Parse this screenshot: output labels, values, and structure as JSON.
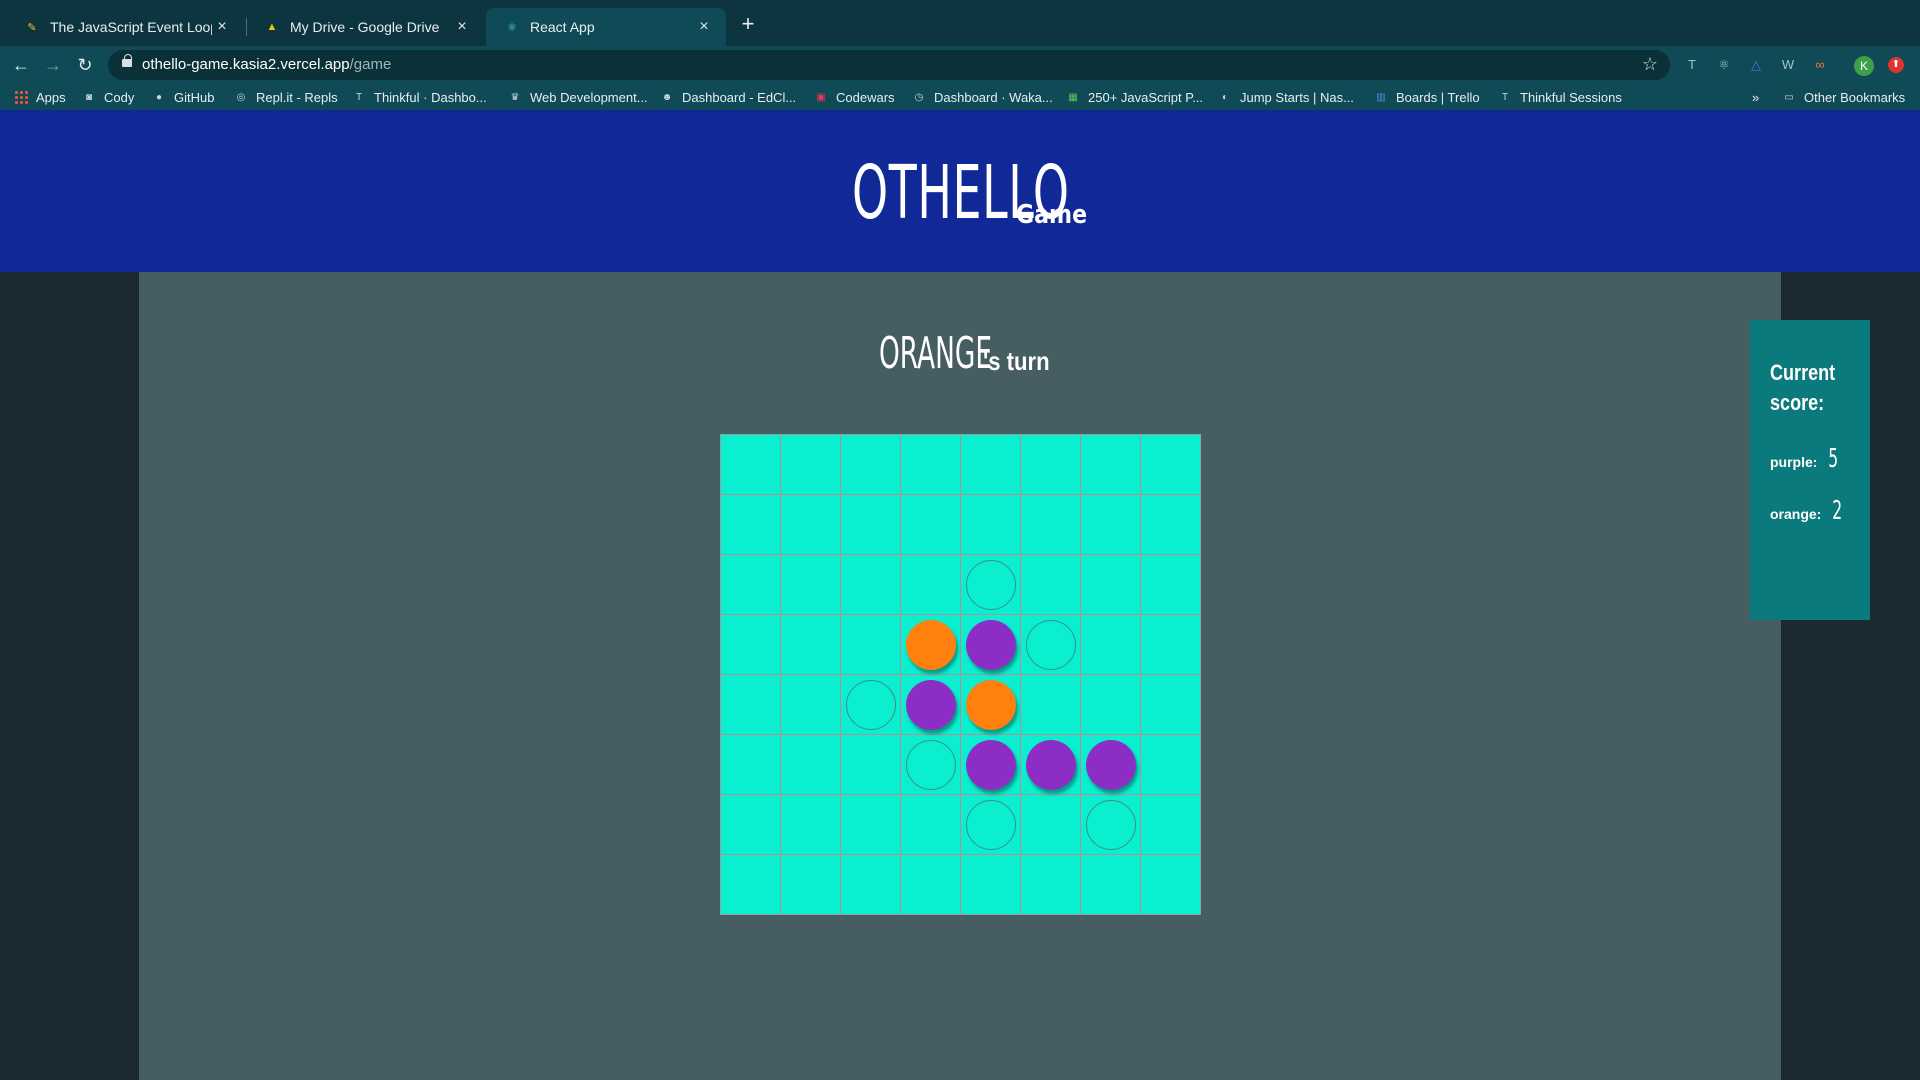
{
  "browser": {
    "tabs": [
      {
        "title": "The JavaScript Event Loop",
        "icon": "js-favicon-icon"
      },
      {
        "title": "My Drive - Google Drive",
        "icon": "google-drive-icon"
      },
      {
        "title": "React App",
        "icon": "react-icon",
        "active": true
      }
    ],
    "url_host": "othello-game.kasia2.vercel.app",
    "url_path": "/game",
    "bookmarks": [
      {
        "label": "Apps",
        "icon": "apps-grid-icon"
      },
      {
        "label": "Cody",
        "icon": "cody-icon"
      },
      {
        "label": "GitHub",
        "icon": "github-icon"
      },
      {
        "label": "Repl.it - Repls",
        "icon": "replit-icon"
      },
      {
        "label": "Thinkful · Dashbo...",
        "icon": "thinkful-icon"
      },
      {
        "label": "Web Development...",
        "icon": "web-dev-icon"
      },
      {
        "label": "Dashboard - EdCl...",
        "icon": "edclub-icon"
      },
      {
        "label": "Codewars",
        "icon": "codewars-icon"
      },
      {
        "label": "Dashboard · Waka...",
        "icon": "wakatime-icon"
      },
      {
        "label": "250+ JavaScript P...",
        "icon": "js-projects-icon"
      },
      {
        "label": "Jump Starts | Nas...",
        "icon": "nasa-icon"
      },
      {
        "label": "Boards | Trello",
        "icon": "trello-icon"
      },
      {
        "label": "Thinkful Sessions",
        "icon": "thinkful-icon"
      }
    ],
    "more_bookmarks": "»",
    "other_bookmarks": "Other Bookmarks",
    "avatar_initial": "K"
  },
  "app": {
    "title": "OTHELLO",
    "subtitle": "Game",
    "turn_player": "ORANGE",
    "turn_suffix": "'s turn",
    "board": [
      [
        0,
        0,
        0,
        0,
        0,
        0,
        0,
        0
      ],
      [
        0,
        0,
        0,
        0,
        0,
        0,
        0,
        0
      ],
      [
        0,
        0,
        0,
        0,
        3,
        0,
        0,
        0
      ],
      [
        0,
        0,
        0,
        2,
        1,
        3,
        0,
        0
      ],
      [
        0,
        0,
        3,
        1,
        2,
        0,
        0,
        0
      ],
      [
        0,
        0,
        0,
        3,
        1,
        1,
        1,
        0
      ],
      [
        0,
        0,
        0,
        0,
        3,
        0,
        3,
        0
      ],
      [
        0,
        0,
        0,
        0,
        0,
        0,
        0,
        0
      ]
    ],
    "board_legend": {
      "0": "empty",
      "1": "purple",
      "2": "orange",
      "3": "valid-move"
    },
    "score": {
      "title": "Current score:",
      "purple_label": "purple:",
      "purple": "5",
      "orange_label": "orange:",
      "orange": "2"
    },
    "colors": {
      "header": "#112897",
      "board": "#09efd0",
      "purple": "#8c2ec6",
      "orange": "#ff7f0f",
      "score_panel": "#0b7a7c"
    }
  }
}
